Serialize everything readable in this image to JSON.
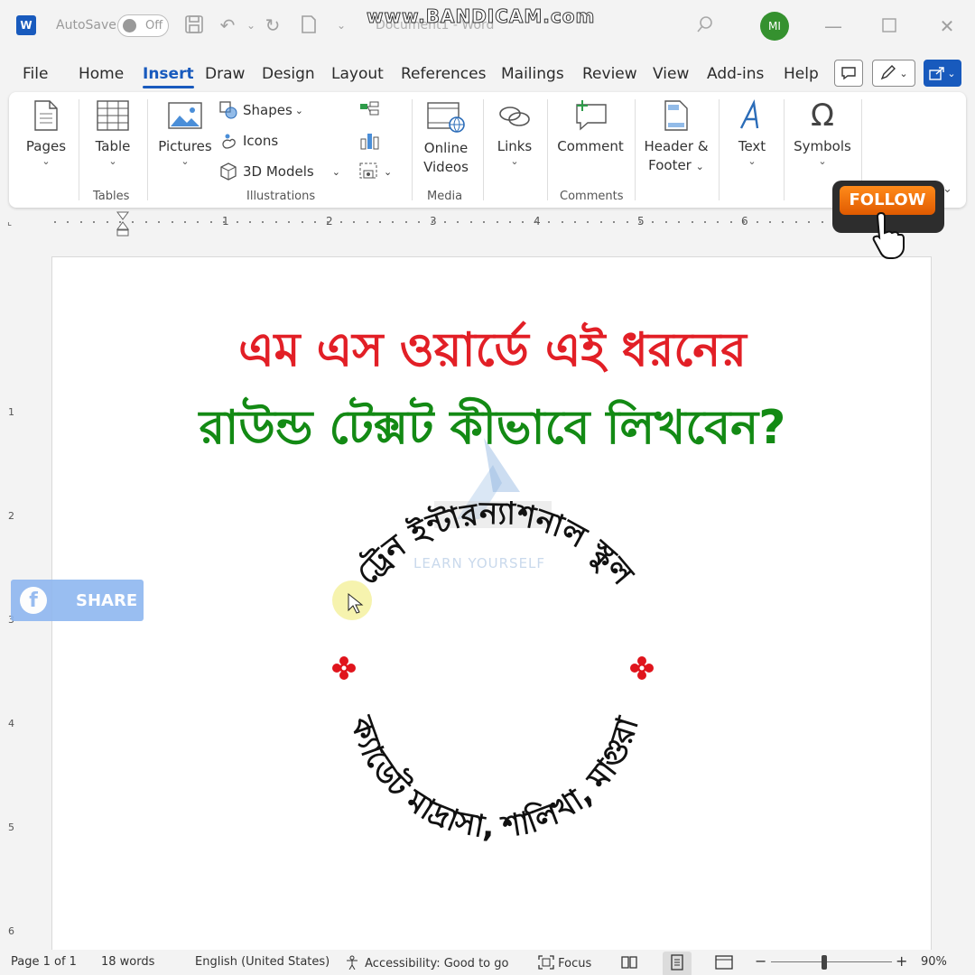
{
  "titlebar": {
    "app_letter": "W",
    "autosave_label": "AutoSave",
    "autosave_state": "Off",
    "document_title": "Document1 - Word",
    "recorder_watermark": "www.BANDICAM.com",
    "avatar_initials": "MI"
  },
  "menu": {
    "tabs": [
      "File",
      "Home",
      "Insert",
      "Draw",
      "Design",
      "Layout",
      "References",
      "Mailings",
      "Review",
      "View",
      "Add-ins",
      "Help"
    ],
    "active_tab": "Insert"
  },
  "ribbon": {
    "pages": "Pages",
    "table": "Table",
    "tables_group": "Tables",
    "pictures": "Pictures",
    "shapes": "Shapes",
    "icons": "Icons",
    "models_3d": "3D Models",
    "illustrations_group": "Illustrations",
    "online_videos_l1": "Online",
    "online_videos_l2": "Videos",
    "media_group": "Media",
    "links": "Links",
    "comment": "Comment",
    "comments_group": "Comments",
    "header_footer_l1": "Header &",
    "header_footer_l2": "Footer",
    "text": "Text",
    "symbols": "Symbols"
  },
  "ruler": {
    "numbers": [
      "1",
      "2",
      "3",
      "4",
      "5",
      "6"
    ],
    "vertical_numbers": [
      "1",
      "2",
      "3",
      "4",
      "5",
      "6"
    ]
  },
  "document": {
    "heading_line1": "এম এস ওয়ার্ডে এই ধরনের",
    "heading_line2": "রাউন্ড টেক্সট কীভাবে লিখবেন?",
    "logo_subtitle": "LEARN YOURSELF",
    "circle_text_top": "ট্রেন ইন্টারন্যাশনাল স্কুল",
    "circle_text_bottom": "ক্যাডেট মাদ্রাসা, শালিখা, মাগুরা"
  },
  "overlays": {
    "share_label": "SHARE",
    "follow_label": "FOLLOW"
  },
  "status": {
    "page": "Page 1 of 1",
    "words": "18 words",
    "language": "English (United States)",
    "accessibility": "Accessibility: Good to go",
    "focus": "Focus",
    "zoom": "90%"
  },
  "colors": {
    "accent": "#185abd",
    "heading_red": "#e21f26",
    "heading_green": "#138a14",
    "flower_red": "#e0141c"
  }
}
